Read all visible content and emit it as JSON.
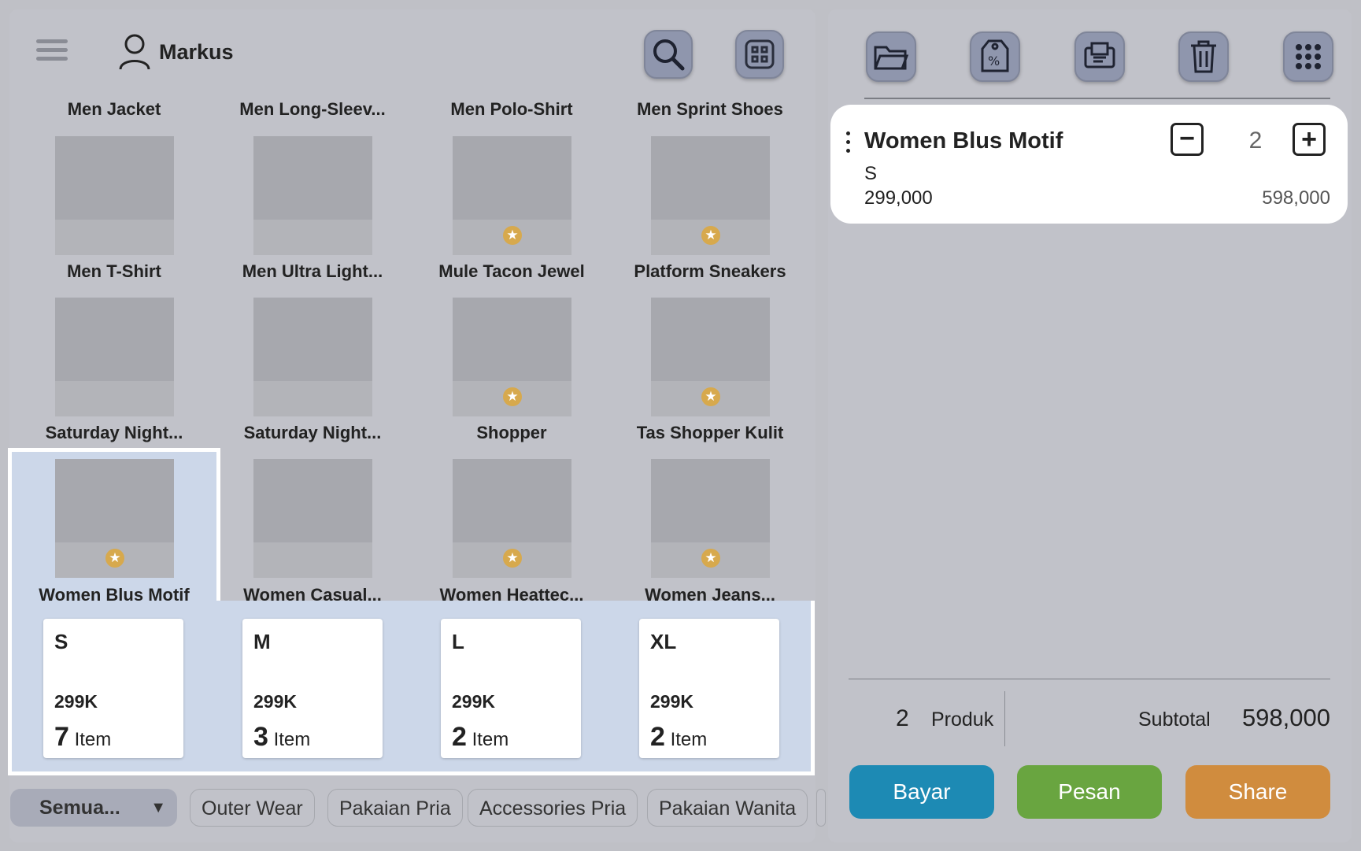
{
  "header": {
    "user_name": "Markus"
  },
  "products": [
    {
      "label": "Men Jacket"
    },
    {
      "label": "Men Long-Sleev..."
    },
    {
      "label": "Men Polo-Shirt"
    },
    {
      "label": "Men Sprint Shoes"
    },
    {
      "label": "Men T-Shirt"
    },
    {
      "label": "Men Ultra Light..."
    },
    {
      "label": "Mule Tacon Jewel"
    },
    {
      "label": "Platform Sneakers"
    },
    {
      "label": "Saturday Night..."
    },
    {
      "label": "Saturday Night..."
    },
    {
      "label": "Shopper"
    },
    {
      "label": "Tas Shopper Kulit"
    },
    {
      "label": "Women Blus Motif"
    },
    {
      "label": "Women Casual..."
    },
    {
      "label": "Women Heattec..."
    },
    {
      "label": "Women Jeans..."
    }
  ],
  "sizes": [
    {
      "name": "S",
      "price": "299K",
      "qty": "7",
      "unit": "Item"
    },
    {
      "name": "M",
      "price": "299K",
      "qty": "3",
      "unit": "Item"
    },
    {
      "name": "L",
      "price": "299K",
      "qty": "2",
      "unit": "Item"
    },
    {
      "name": "XL",
      "price": "299K",
      "qty": "2",
      "unit": "Item"
    }
  ],
  "categories": {
    "selected": "Semua...",
    "items": [
      "Outer Wear",
      "Pakaian Pria",
      "Accessories Pria",
      "Pakaian Wanita"
    ]
  },
  "cart": {
    "item_name": "Women Blus Motif",
    "variant": "S",
    "unit_price": "299,000",
    "quantity": "2",
    "line_total": "598,000",
    "minus_label": "−",
    "plus_label": "+"
  },
  "summary": {
    "product_count": "2",
    "product_label": "Produk",
    "subtotal_label": "Subtotal",
    "subtotal_value": "598,000"
  },
  "actions": {
    "pay": "Bayar",
    "order": "Pesan",
    "share": "Share"
  },
  "colors": {
    "pay": "#1d8ab4",
    "order": "#69a540",
    "share": "#d08c3e",
    "highlight": "#ccd7e9"
  },
  "icons": [
    "menu-icon",
    "user-icon",
    "search-icon",
    "grid-icon",
    "folder-icon",
    "discount-tag-icon",
    "receipt-icon",
    "trash-icon",
    "more-dots-icon",
    "star-icon"
  ]
}
